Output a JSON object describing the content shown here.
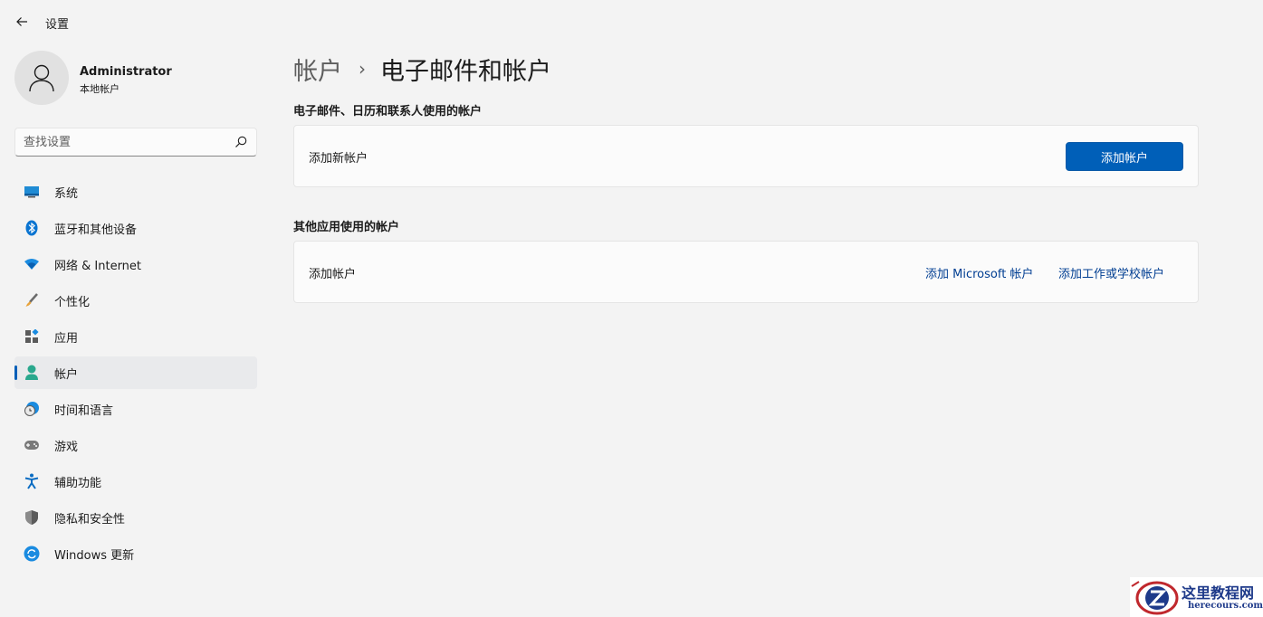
{
  "window": {
    "title": "设置"
  },
  "profile": {
    "name": "Administrator",
    "account_type": "本地帐户"
  },
  "search": {
    "placeholder": "查找设置"
  },
  "sidebar": {
    "items": [
      {
        "label": "系统",
        "icon": "system-icon"
      },
      {
        "label": "蓝牙和其他设备",
        "icon": "bluetooth-icon"
      },
      {
        "label": "网络 & Internet",
        "icon": "wifi-icon"
      },
      {
        "label": "个性化",
        "icon": "brush-icon"
      },
      {
        "label": "应用",
        "icon": "apps-icon"
      },
      {
        "label": "帐户",
        "icon": "account-icon",
        "selected": true
      },
      {
        "label": "时间和语言",
        "icon": "time-language-icon"
      },
      {
        "label": "游戏",
        "icon": "gamepad-icon"
      },
      {
        "label": "辅助功能",
        "icon": "accessibility-icon"
      },
      {
        "label": "隐私和安全性",
        "icon": "shield-icon"
      },
      {
        "label": "Windows 更新",
        "icon": "update-icon"
      }
    ]
  },
  "breadcrumb": {
    "parent": "帐户",
    "separator": "›",
    "current": "电子邮件和帐户"
  },
  "sections": {
    "email": {
      "title": "电子邮件、日历和联系人使用的帐户",
      "card_label": "添加新帐户",
      "button_label": "添加帐户"
    },
    "other": {
      "title": "其他应用使用的帐户",
      "card_label": "添加帐户",
      "link_microsoft": "添加 Microsoft 帐户",
      "link_work": "添加工作或学校帐户"
    }
  },
  "watermark": {
    "text": "这里教程网",
    "url": "herecours.com"
  },
  "colors": {
    "accent": "#005fb8",
    "background": "#f3f3f3",
    "card": "#fbfbfb",
    "link": "#003e92"
  }
}
